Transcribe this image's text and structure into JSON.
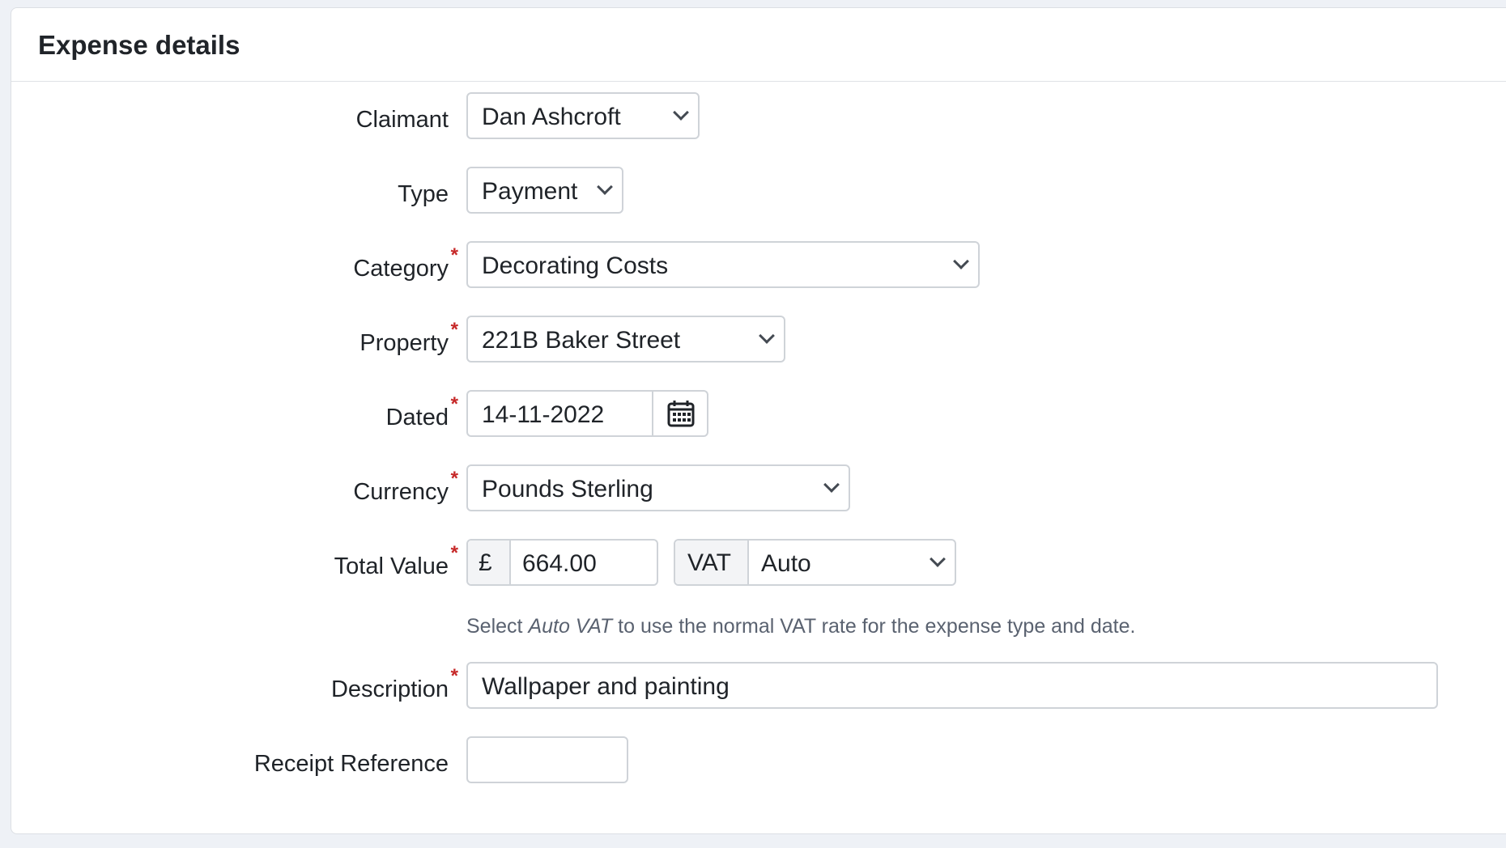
{
  "header": {
    "title": "Expense details"
  },
  "form": {
    "claimant": {
      "label": "Claimant",
      "value": "Dan Ashcroft"
    },
    "type": {
      "label": "Type",
      "value": "Payment"
    },
    "category": {
      "label": "Category",
      "value": "Decorating Costs",
      "required": true
    },
    "property": {
      "label": "Property",
      "value": "221B Baker Street",
      "required": true
    },
    "dated": {
      "label": "Dated",
      "value": "14-11-2022",
      "required": true,
      "icon": "calendar-icon"
    },
    "currency": {
      "label": "Currency",
      "value": "Pounds Sterling",
      "required": true
    },
    "total_value": {
      "label": "Total Value",
      "required": true,
      "currency_symbol": "£",
      "amount": "664.00",
      "vat_label": "VAT",
      "vat_value": "Auto"
    },
    "help": {
      "prefix": "Select ",
      "emphasis": "Auto VAT",
      "suffix": " to use the normal VAT rate for the expense type and date."
    },
    "description": {
      "label": "Description",
      "value": "Wallpaper and painting",
      "required": true
    },
    "receipt_reference": {
      "label": "Receipt Reference",
      "value": ""
    }
  },
  "colors": {
    "required_marker": "#c62828",
    "border": "#cfd3d8",
    "help_text": "#5a6270"
  }
}
